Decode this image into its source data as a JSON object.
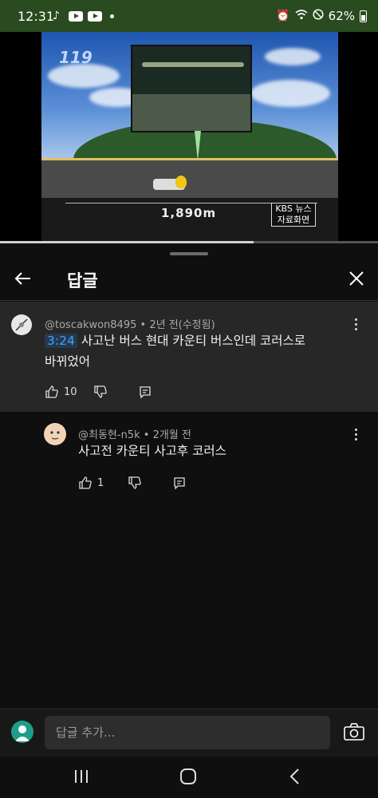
{
  "status_bar": {
    "time": "12:31",
    "battery": "62%",
    "icons": [
      "tiktok-icon",
      "youtube-icon",
      "youtube-icon",
      "notification-dot",
      "alarm-icon",
      "wifi-icon",
      "do-not-disturb-icon",
      "battery-icon"
    ]
  },
  "video": {
    "distance_label": "1,890m",
    "badge_line1": "KBS 뉴스",
    "badge_line2": "자료화면",
    "logo_text": "119",
    "progress": 0.67
  },
  "panel": {
    "title": "답글"
  },
  "comments": [
    {
      "handle": "@toscakwon8495",
      "meta": "2년 전(수정됨)",
      "timestamp": "3:24",
      "text_first": "사고난 버스 현대 카운티 버스인데 코러스로",
      "text_second": "바뀌었어",
      "likes": "10"
    },
    {
      "handle": "@최동현-n5k",
      "meta": "2개월 전",
      "text": "사고전 카운티 사고후 코러스",
      "likes": "1"
    }
  ],
  "composer": {
    "placeholder": "답글 추가..."
  },
  "colors": {
    "background": "#0f0f0f",
    "highlight_comment": "#272727",
    "link": "#3ea6ff",
    "status_bar": "#2a4a1f"
  }
}
